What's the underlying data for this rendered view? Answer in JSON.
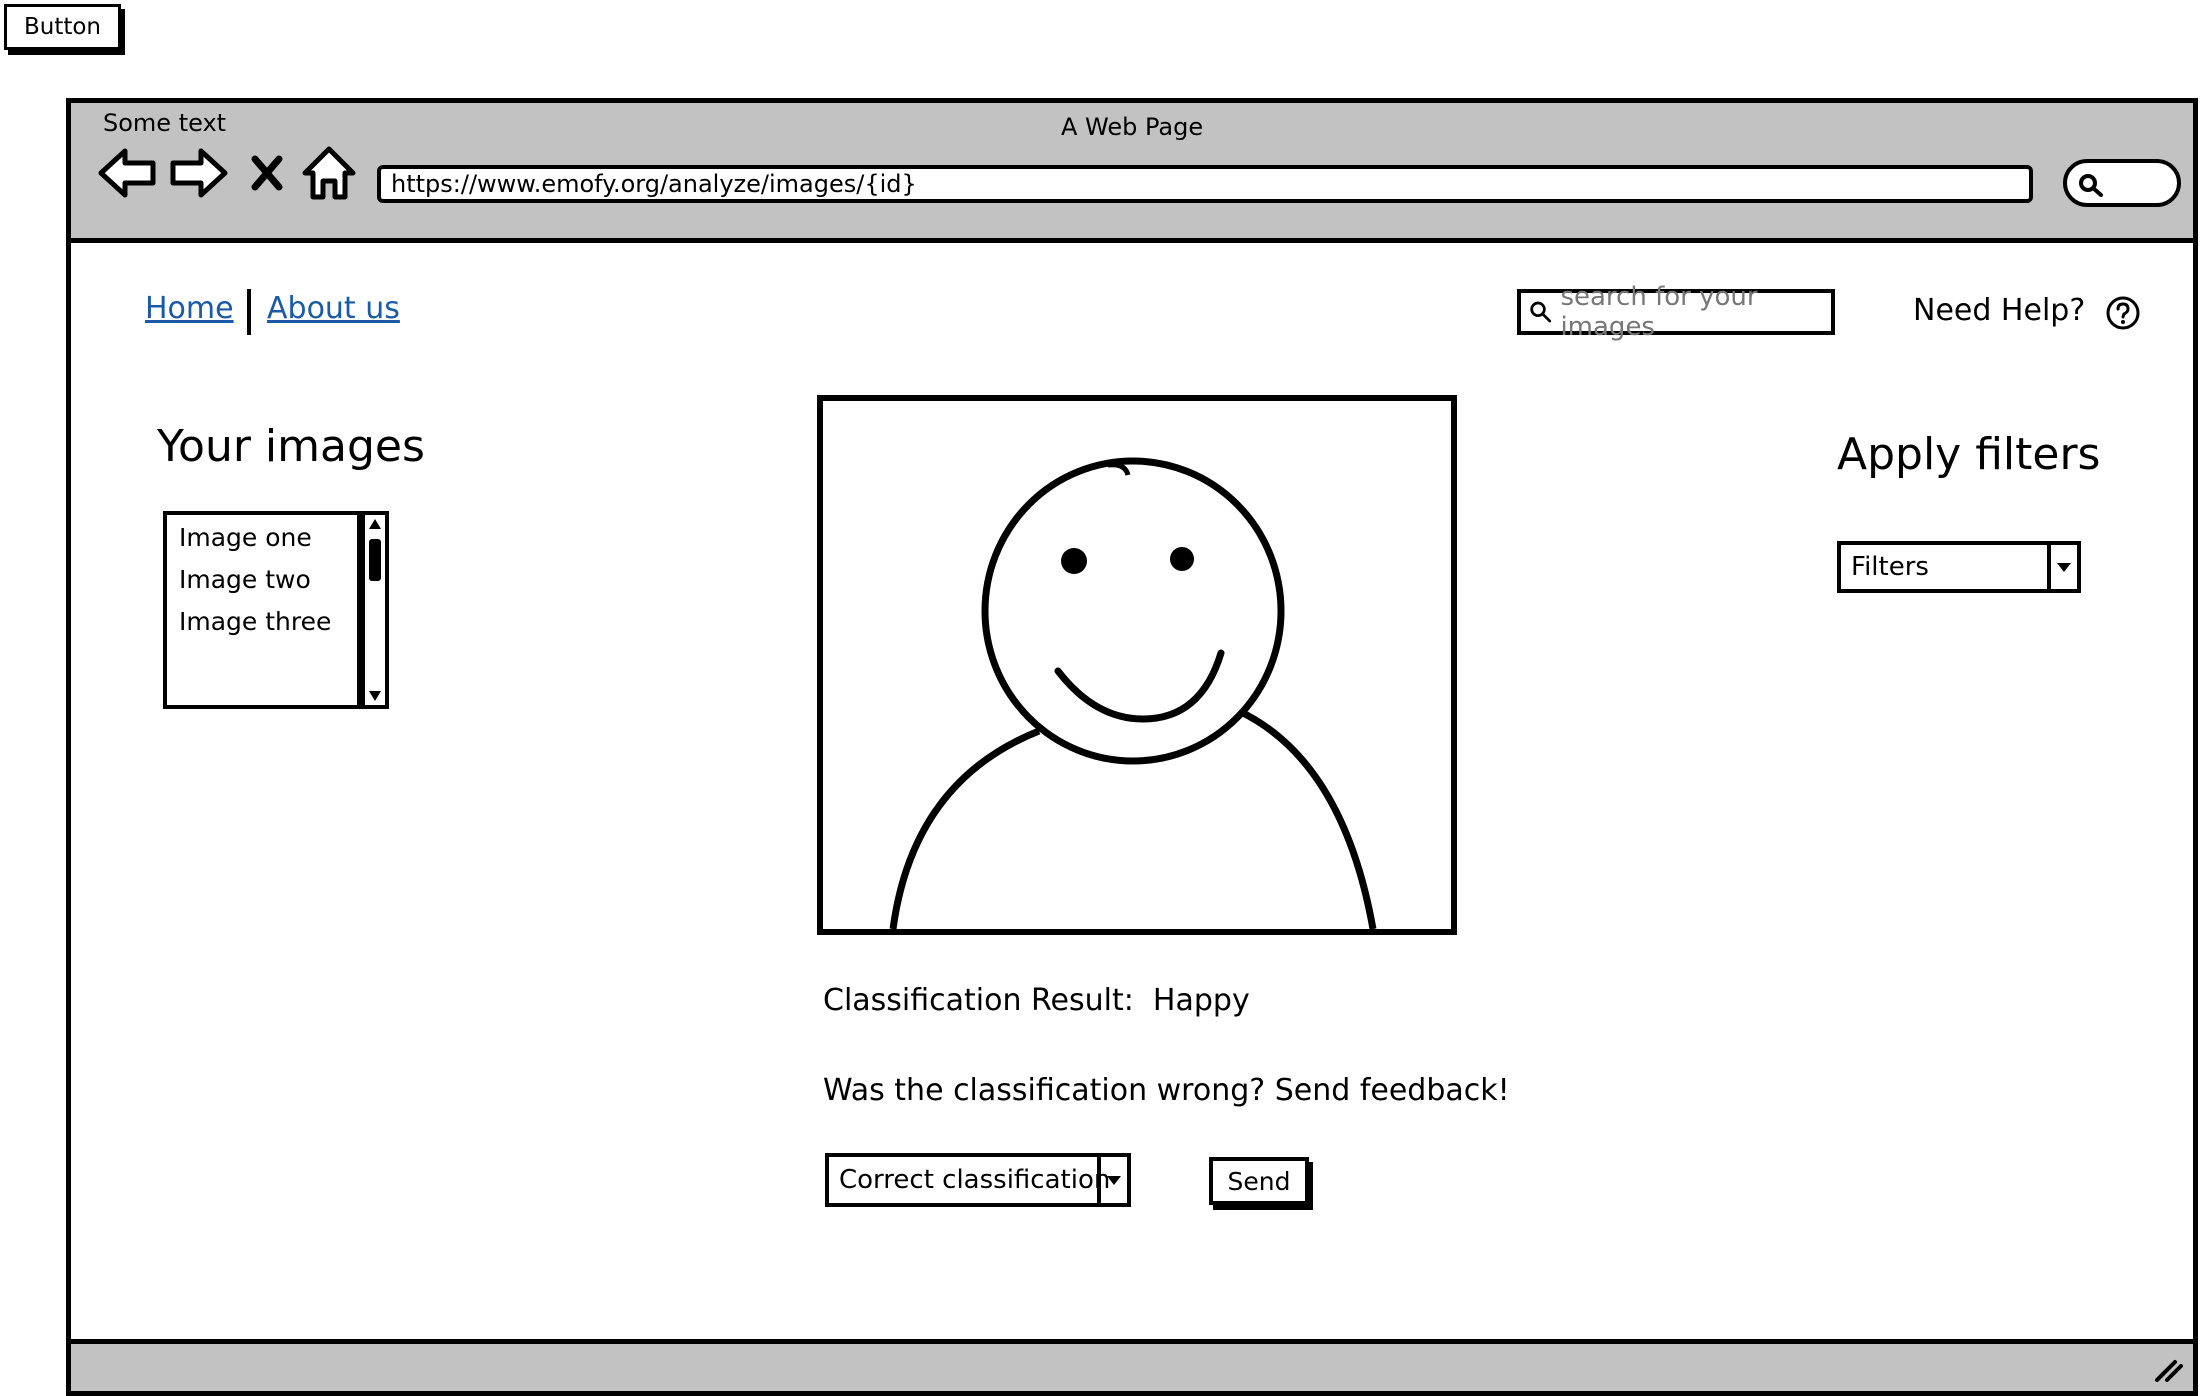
{
  "loose_button": {
    "label": "Button"
  },
  "browser": {
    "small_text": "Some text",
    "title": "A Web Page",
    "url": "https://www.emofy.org/analyze/images/{id}"
  },
  "nav": {
    "home": "Home",
    "about": "About us"
  },
  "search": {
    "placeholder": "search for your images"
  },
  "help": {
    "label": "Need Help?"
  },
  "images_panel": {
    "heading": "Your images",
    "items": [
      "Image one",
      "Image two",
      "Image three"
    ]
  },
  "filters_panel": {
    "heading": "Apply filters",
    "select_value": "Filters"
  },
  "result": {
    "label": "Classification Result:",
    "value": "Happy"
  },
  "feedback": {
    "prompt": "Was the classification wrong? Send feedback!",
    "select_value": "Correct classification",
    "send_label": "Send"
  },
  "icons": {
    "back": "arrow-left-icon",
    "forward": "arrow-right-icon",
    "stop": "close-icon",
    "home": "home-icon",
    "search": "search-icon",
    "help": "question-circle-icon",
    "resize": "resize-grip-icon"
  }
}
